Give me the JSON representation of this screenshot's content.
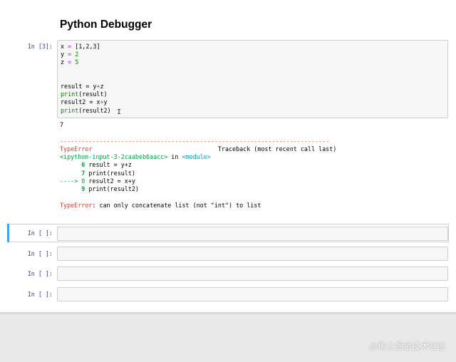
{
  "notebook": {
    "heading": "Python Debugger",
    "cell3": {
      "prompt": "In [3]:",
      "code": {
        "l1_var": "x",
        "l1_op": " = ",
        "l1_val": "[1,2,3]",
        "l2_var": "y",
        "l2_op": " = ",
        "l2_val": "2",
        "l3_var": "z",
        "l3_op": " = ",
        "l3_val": "5",
        "l4_pre": "result = y",
        "l4_op": "+",
        "l4_post": "z",
        "l5_fn": "print",
        "l5_arg": "(result)",
        "l6_pre": "result2 = x",
        "l6_op": "+",
        "l6_post": "y",
        "l7_fn": "print",
        "l7_arg": "(result2)"
      },
      "output": {
        "value": "7",
        "dashes": "---------------------------------------------------------------------------",
        "err_name": "TypeError",
        "traceback_label": "Traceback (most recent call last)",
        "input_ref": "<ipython-input-3-2caabeb6aacc>",
        "in_word": " in ",
        "module_ref": "<module>",
        "tb1_num": "6",
        "tb1_text": " result = y+z",
        "tb2_num": "7",
        "tb2_text": " print(result)",
        "tb3_arrow": "----> 8",
        "tb3_text": " result2 = x+y",
        "tb4_num": "9",
        "tb4_text": " print(result2)",
        "final_err_name": "TypeError",
        "final_err_msg": ": can only concatenate list (not \"int\") to list"
      }
    },
    "empty_cells": [
      {
        "prompt": "In [ ]:"
      },
      {
        "prompt": "In [ ]:"
      },
      {
        "prompt": "In [ ]:"
      },
      {
        "prompt": "In [ ]:"
      }
    ]
  },
  "watermark": "@稀土掘金技术社区",
  "colors": {
    "prompt": "#303f9f",
    "error": "#e53935",
    "green": "#00a047",
    "cyan": "#00a0b0",
    "selected": "#42a5f5"
  }
}
